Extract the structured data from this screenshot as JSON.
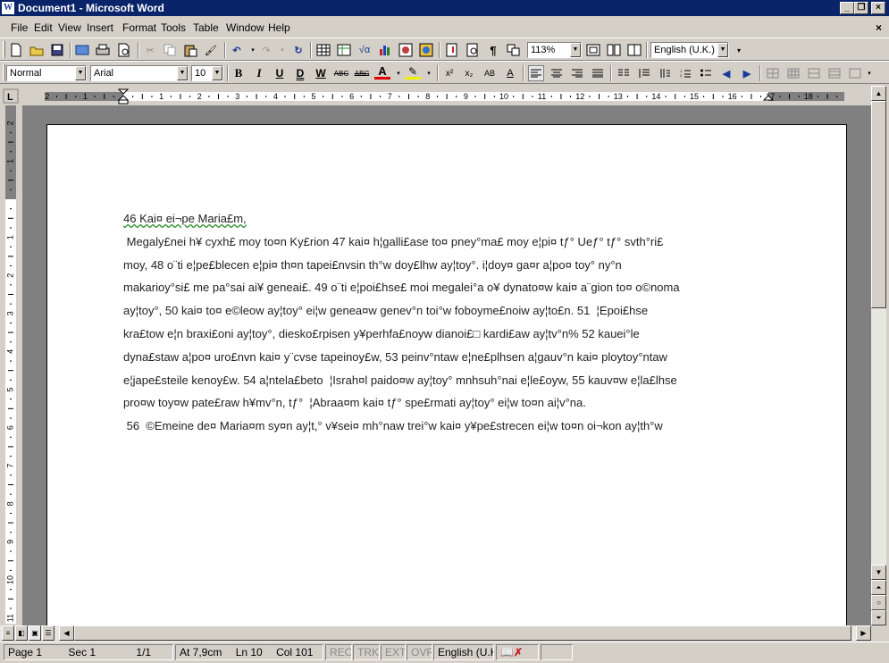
{
  "window": {
    "title": "Document1 - Microsoft Word",
    "app_icon_letter": "W"
  },
  "menu": [
    "File",
    "Edit",
    "View",
    "Insert",
    "Format",
    "Tools",
    "Table",
    "Window",
    "Help"
  ],
  "toolbar_standard": {
    "icons": [
      "new-document-icon",
      "open-folder-icon",
      "save-icon",
      "web-permission-icon",
      "print-icon",
      "print-preview-icon",
      "cut-icon",
      "copy-icon",
      "paste-icon",
      "format-painter-icon",
      "undo-icon",
      "redo-icon",
      "refresh-icon",
      "insert-table-icon",
      "insert-excel-icon",
      "insert-formula-icon",
      "insert-chart-icon",
      "insert-object-icon",
      "map-icon",
      "show-hide-icon",
      "document-map-icon",
      "paragraph-mark-icon",
      "view-icon",
      "zoom-fit-icon"
    ],
    "zoom": "113%",
    "language": "English (U.K.)"
  },
  "toolbar_formatting": {
    "style": "Normal",
    "font": "Arial",
    "size": "10",
    "buttons": {
      "bold": "B",
      "italic": "I",
      "underline": "U",
      "double_underline": "D",
      "word_underline": "W",
      "strike": "ABC",
      "double_strike": "ABC",
      "font_color": "A",
      "highlight": "✎",
      "superscript": "x²",
      "subscript": "x₂",
      "all_caps": "AB",
      "character_spacing": "A"
    }
  },
  "ruler": {
    "h_labels": [
      "2",
      "1",
      "1",
      "2",
      "3",
      "4",
      "5",
      "6",
      "7",
      "8",
      "9",
      "10",
      "11",
      "12",
      "13",
      "14",
      "15",
      "16",
      "17",
      "18"
    ],
    "v_labels": [
      "2",
      "1",
      "1",
      "2",
      "3",
      "4",
      "5",
      "6",
      "7",
      "8",
      "9",
      "10",
      "11"
    ]
  },
  "document": {
    "lines": [
      "46 Kai¤ ei¬pe Maria£m,",
      " Megaly£nei h¥ cyxh£ moy to¤n Ky£rion 47 kai¤ h¦galli£ase to¤ pney°ma£ moy e¦pi¤ tƒ° Ueƒ° tƒ° svth°ri£",
      "moy, 48 o¨ti e¦pe£blecen e¦pi¤ th¤n tapei£nvsin th°w doy£lhw ay¦toy°. i¦doy¤ ga¤r a¦po¤ toy° ny°n",
      "makarioy°si£ me pa°sai ai¥ geneai£. 49 o¨ti e¦poi£hse£ moi megalei°a o¥ dynato¤w kai¤ a¨gion to¤ o©noma",
      "ay¦toy°, 50 kai¤ to¤ e©leow ay¦toy° ei¦w genea¤w genev°n toi°w foboyme£noiw ay¦to£n. 51  ¦Epoi£hse",
      "kra£tow e¦n braxi£oni ay¦toy°, diesko£rpisen y¥perhfa£noyw dianoi£□ kardi£aw ay¦tv°n% 52 kauei°le",
      "dyna£staw a¦po¤ uro£nvn kai¤ y¨cvse tapeinoy£w, 53 peinv°ntaw e¦ne£plhsen a¦gauv°n kai¤ ploytoy°ntaw",
      "e¦jape£steile kenoy£w. 54 a¦ntela£beto  ¦Israh¤l paido¤w ay¦toy° mnhsuh°nai e¦le£oyw, 55 kauv¤w e¦la£lhse",
      "pro¤w toy¤w pate£raw h¥mv°n, tƒ°  ¦Abraa¤m kai¤ tƒ° spe£rmati ay¦toy° ei¦w to¤n ai¦v°na.",
      " 56  ©Emeine de¤ Maria¤m sy¤n ay¦t,° v¥sei¤ mh°naw trei°w kai¤ y¥pe£strecen ei¦w to¤n oi¬kon ay¦th°w"
    ]
  },
  "status": {
    "page": "Page 1",
    "section": "Sec 1",
    "pages": "1/1",
    "at": "At 7,9cm",
    "line": "Ln 10",
    "col": "Col 101",
    "rec": "REC",
    "trk": "TRK",
    "ext": "EXT",
    "ovr": "OVR",
    "language": "English (U.K"
  }
}
